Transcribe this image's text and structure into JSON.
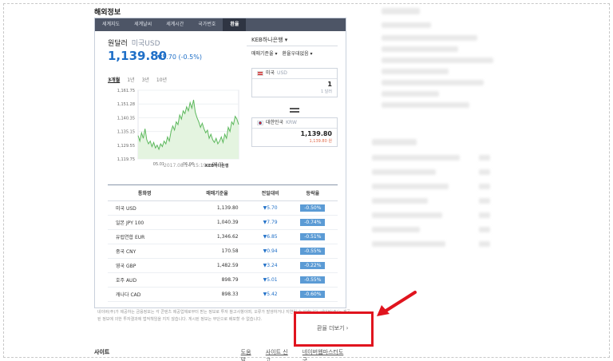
{
  "section_title": "해외정보",
  "tabs": [
    {
      "label": "세계지도"
    },
    {
      "label": "세계날씨"
    },
    {
      "label": "세계시간"
    },
    {
      "label": "국가번호"
    },
    {
      "label": "환율",
      "active": true
    }
  ],
  "currency": {
    "name": "원달러",
    "name_sub": "미국USD",
    "rate": "1,139.80",
    "change": "▼5.70 (-0.5%)"
  },
  "bank_select": "KEB하나은행 ▾",
  "options": [
    "매매기준율 ▾",
    "환율우대없음 ▾"
  ],
  "periods": [
    {
      "label": "3개월",
      "active": true
    },
    {
      "label": "1년"
    },
    {
      "label": "3년"
    },
    {
      "label": "10년"
    }
  ],
  "chart_data": {
    "type": "line",
    "y_ticks": [
      "1,161.75",
      "1,151.28",
      "1,140.35",
      "1,135.15",
      "1,129.55",
      "1,119.75"
    ],
    "x_ticks": [
      "05.01",
      "06.06",
      "07.01"
    ],
    "ylim": [
      1115,
      1165
    ],
    "values": [
      1132,
      1128,
      1134,
      1130,
      1137,
      1129,
      1126,
      1128,
      1124,
      1127,
      1123,
      1125,
      1122,
      1126,
      1124,
      1128,
      1126,
      1131,
      1128,
      1135,
      1139,
      1136,
      1142,
      1140,
      1147,
      1144,
      1150,
      1148,
      1153,
      1150,
      1156,
      1152,
      1158,
      1149,
      1145,
      1142,
      1138,
      1141,
      1137,
      1134,
      1136,
      1130,
      1133,
      1129,
      1127,
      1130,
      1126,
      1128,
      1131,
      1127,
      1133,
      1130,
      1138,
      1135,
      1142,
      1140,
      1146,
      1144,
      1140
    ],
    "color": "#5cb85c",
    "fill": "#e4f4e0",
    "date": "2017.08.14 15:19",
    "bank_logo_text": "KEB하나은행"
  },
  "converter": {
    "from_label": "미국",
    "from_code": "USD",
    "from_value": "1",
    "from_unit": "1 달러",
    "to_label": "대한민국",
    "to_code": "KRW",
    "to_value": "1,139.80",
    "to_unit": "1,139.80 원"
  },
  "table": {
    "headers": [
      "통화명",
      "매매기준율",
      "전일대비",
      "등락율"
    ],
    "rows": [
      {
        "name": "미국 USD",
        "rate": "1,139.80",
        "change": "▼5.70",
        "pct": "-0.50%"
      },
      {
        "name": "일본 JPY 100",
        "rate": "1,040.39",
        "change": "▼7.79",
        "pct": "-0.74%"
      },
      {
        "name": "유럽연합 EUR",
        "rate": "1,346.62",
        "change": "▼6.85",
        "pct": "-0.51%"
      },
      {
        "name": "중국 CNY",
        "rate": "170.58",
        "change": "▼0.94",
        "pct": "-0.55%"
      },
      {
        "name": "영국 GBP",
        "rate": "1,482.59",
        "change": "▼3.24",
        "pct": "-0.22%"
      },
      {
        "name": "호주 AUD",
        "rate": "898.79",
        "change": "▼5.01",
        "pct": "-0.55%"
      },
      {
        "name": "캐나다 CAD",
        "rate": "898.33",
        "change": "▼5.42",
        "pct": "-0.60%"
      }
    ]
  },
  "notice": "네이버(주)가 제공하는 금융정보는 각 콘텐츠 제공업체로부터 받는 정보로 투자 참고사항이며, 오류가 발생하거나 지연될 수 있습니다. 네이버(주)는 제공된 정보에 의한 투자결과에 법적책임을 지지 않습니다. 게시된 정보는 무단으로 배포할 수 없습니다.",
  "more_link": "환율 더보기 ›",
  "footer": {
    "title": "사이트",
    "links": [
      "도움말",
      "사이트 신고",
      "네이버웹마스터도구"
    ]
  },
  "annotation_color": "#e0141e"
}
